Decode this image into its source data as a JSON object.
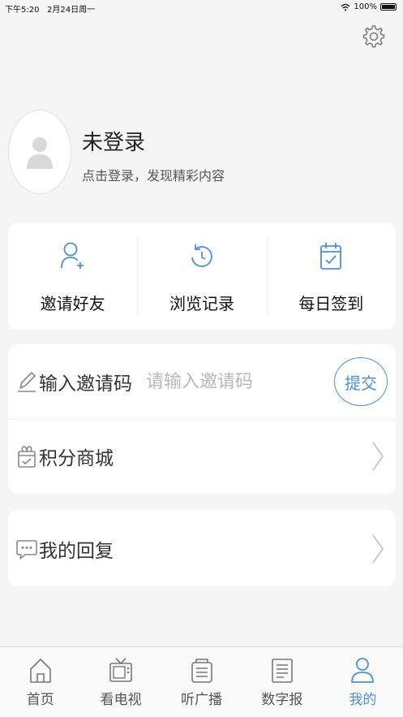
{
  "status_bar": {
    "time": "下午5:20",
    "date": "2月24日周一",
    "battery": "100%"
  },
  "header": {
    "settings_icon": "gear-icon"
  },
  "profile": {
    "name": "未登录",
    "subtitle": "点击登录，发现精彩内容",
    "avatar_icon": "user-silhouette-icon"
  },
  "quick_actions": [
    {
      "label": "邀请好友",
      "icon": "add-user-icon"
    },
    {
      "label": "浏览记录",
      "icon": "history-clock-icon"
    },
    {
      "label": "每日签到",
      "icon": "calendar-check-icon"
    }
  ],
  "invite": {
    "label": "输入邀请码",
    "placeholder": "请输入邀请码",
    "value": "",
    "submit_label": "提交",
    "icon": "pencil-icon"
  },
  "mall": {
    "label": "积分商城",
    "icon": "gift-icon"
  },
  "replies": {
    "label": "我的回复",
    "icon": "chat-bubble-icon"
  },
  "tabs": [
    {
      "label": "首页",
      "icon": "home-icon",
      "active": false
    },
    {
      "label": "看电视",
      "icon": "tv-icon",
      "active": false
    },
    {
      "label": "听广播",
      "icon": "radio-icon",
      "active": false
    },
    {
      "label": "数字报",
      "icon": "newspaper-icon",
      "active": false
    },
    {
      "label": "我的",
      "icon": "person-icon",
      "active": true
    }
  ],
  "colors": {
    "accent": "#4a90e2",
    "background": "#f5f5f5",
    "card": "#ffffff"
  }
}
